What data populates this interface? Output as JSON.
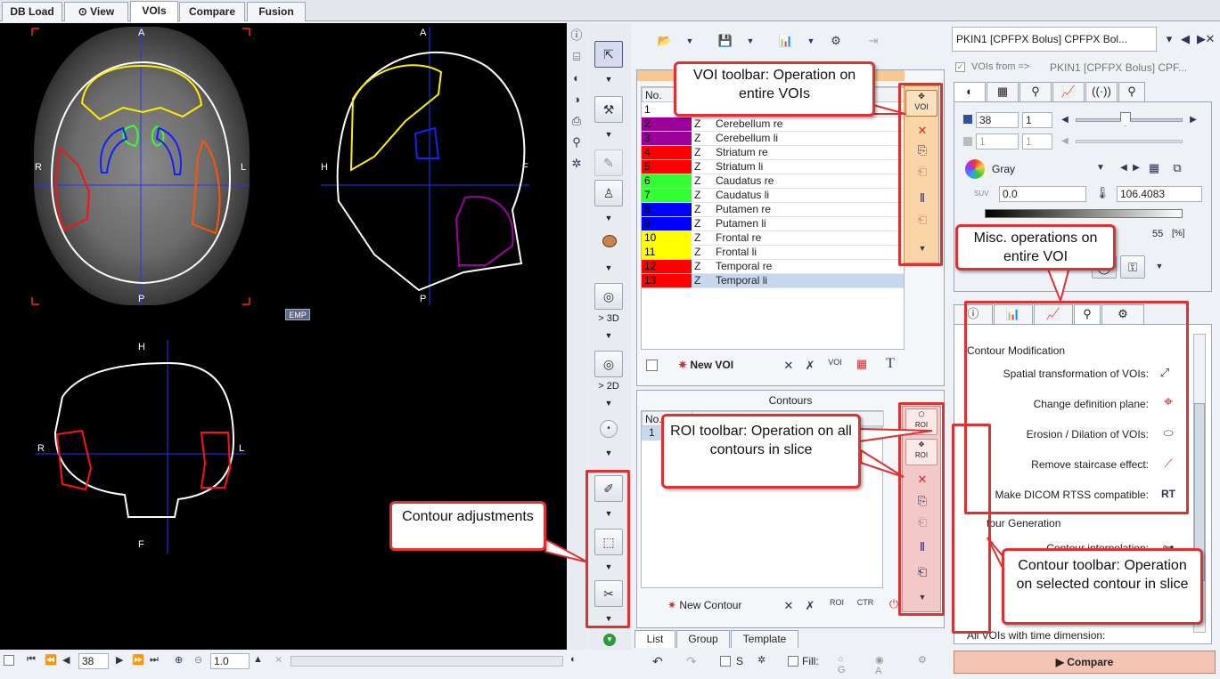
{
  "tabs": [
    {
      "label": "DB Load"
    },
    {
      "label": "View"
    },
    {
      "label": "VOIs"
    },
    {
      "label": "Compare"
    },
    {
      "label": "Fusion"
    }
  ],
  "viewer": {
    "axial_labels": {
      "top": "A",
      "bottom": "P",
      "left": "R",
      "right": "L"
    },
    "sagittal_labels": {
      "top": "A",
      "bottom": "P",
      "left": "H",
      "right": "F"
    },
    "coronal_labels": {
      "top": "H",
      "bottom": "F",
      "left": "R",
      "right": "L"
    },
    "badge": "EMP"
  },
  "vtool": {
    "label_3d": "> 3D",
    "label_2d": "> 2D"
  },
  "voi_list": {
    "col_no": "No.",
    "rows": [
      {
        "no": "1",
        "flag": "",
        "name": "",
        "color": "#ffffff"
      },
      {
        "no": "2",
        "flag": "Z",
        "name": "Cerebellum re",
        "color": "#9b009b"
      },
      {
        "no": "3",
        "flag": "Z",
        "name": "Cerebellum li",
        "color": "#9b009b"
      },
      {
        "no": "4",
        "flag": "Z",
        "name": "Striatum re",
        "color": "#ff0000"
      },
      {
        "no": "5",
        "flag": "Z",
        "name": "Striatum li",
        "color": "#ff0000"
      },
      {
        "no": "6",
        "flag": "Z",
        "name": "Caudatus re",
        "color": "#33ff33"
      },
      {
        "no": "7",
        "flag": "Z",
        "name": "Caudatus li",
        "color": "#33ff33"
      },
      {
        "no": "8",
        "flag": "Z",
        "name": "Putamen re",
        "color": "#0000ff"
      },
      {
        "no": "9",
        "flag": "Z",
        "name": "Putamen li",
        "color": "#0000ff"
      },
      {
        "no": "10",
        "flag": "Z",
        "name": "Frontal re",
        "color": "#ffff00"
      },
      {
        "no": "11",
        "flag": "Z",
        "name": "Frontal li",
        "color": "#ffff00"
      },
      {
        "no": "12",
        "flag": "Z",
        "name": "Temporal re",
        "color": "#ff0000"
      },
      {
        "no": "13",
        "flag": "Z",
        "name": "Temporal li",
        "color": "#ff0000"
      }
    ],
    "new_voi": "New VOI"
  },
  "contours": {
    "title": "Contours",
    "col_no": "No.",
    "row1": "1",
    "new_contour": "New Contour"
  },
  "list_tabs": [
    {
      "label": "List"
    },
    {
      "label": "Group"
    },
    {
      "label": "Template"
    }
  ],
  "right": {
    "series": "PKIN1 [CPFPX Bolus] CPFPX Bol...",
    "vois_from": "VOIs from =>",
    "vois_from_value": "PKIN1 [CPFPX Bolus] CPF...",
    "slice": "38",
    "frame": "1",
    "slice2": "1",
    "frame2": "1",
    "colormap": "Gray",
    "min": "0.0",
    "max": "106.4083",
    "percent": "55",
    "percent_unit": "[%]",
    "section_contour_mod": "Contour Modification",
    "ops": [
      {
        "label": "Spatial transformation of VOIs:"
      },
      {
        "label": "Change definition plane:"
      },
      {
        "label": "Erosion / Dilation of VOIs:"
      },
      {
        "label": "Remove staircase effect:"
      },
      {
        "label": "Make DICOM RTSS compatible:"
      }
    ],
    "section_contour_gen": "tour Generation",
    "interp": "Contour interpolation:",
    "time_dim": "All VOIs with time dimension:",
    "compare": "Compare"
  },
  "bottom": {
    "slice": "38",
    "zoom": "1.0",
    "s_label": "S",
    "fill_label": "Fill:",
    "g_label": "G",
    "a_label": "A"
  },
  "callouts": {
    "voi_toolbar": "VOI toolbar: Operation on entire VOIs",
    "misc_ops": "Misc. operations on entire VOI",
    "roi_toolbar": "ROI toolbar: Operation on all contours in slice",
    "contour_adj": "Contour adjustments",
    "contour_toolbar": "Contour toolbar: Operation on selected contour in slice"
  },
  "icons": {
    "voi_label": "VOI",
    "roi_label": "ROI",
    "ctr_label": "CTR",
    "rt_label": "RT"
  }
}
